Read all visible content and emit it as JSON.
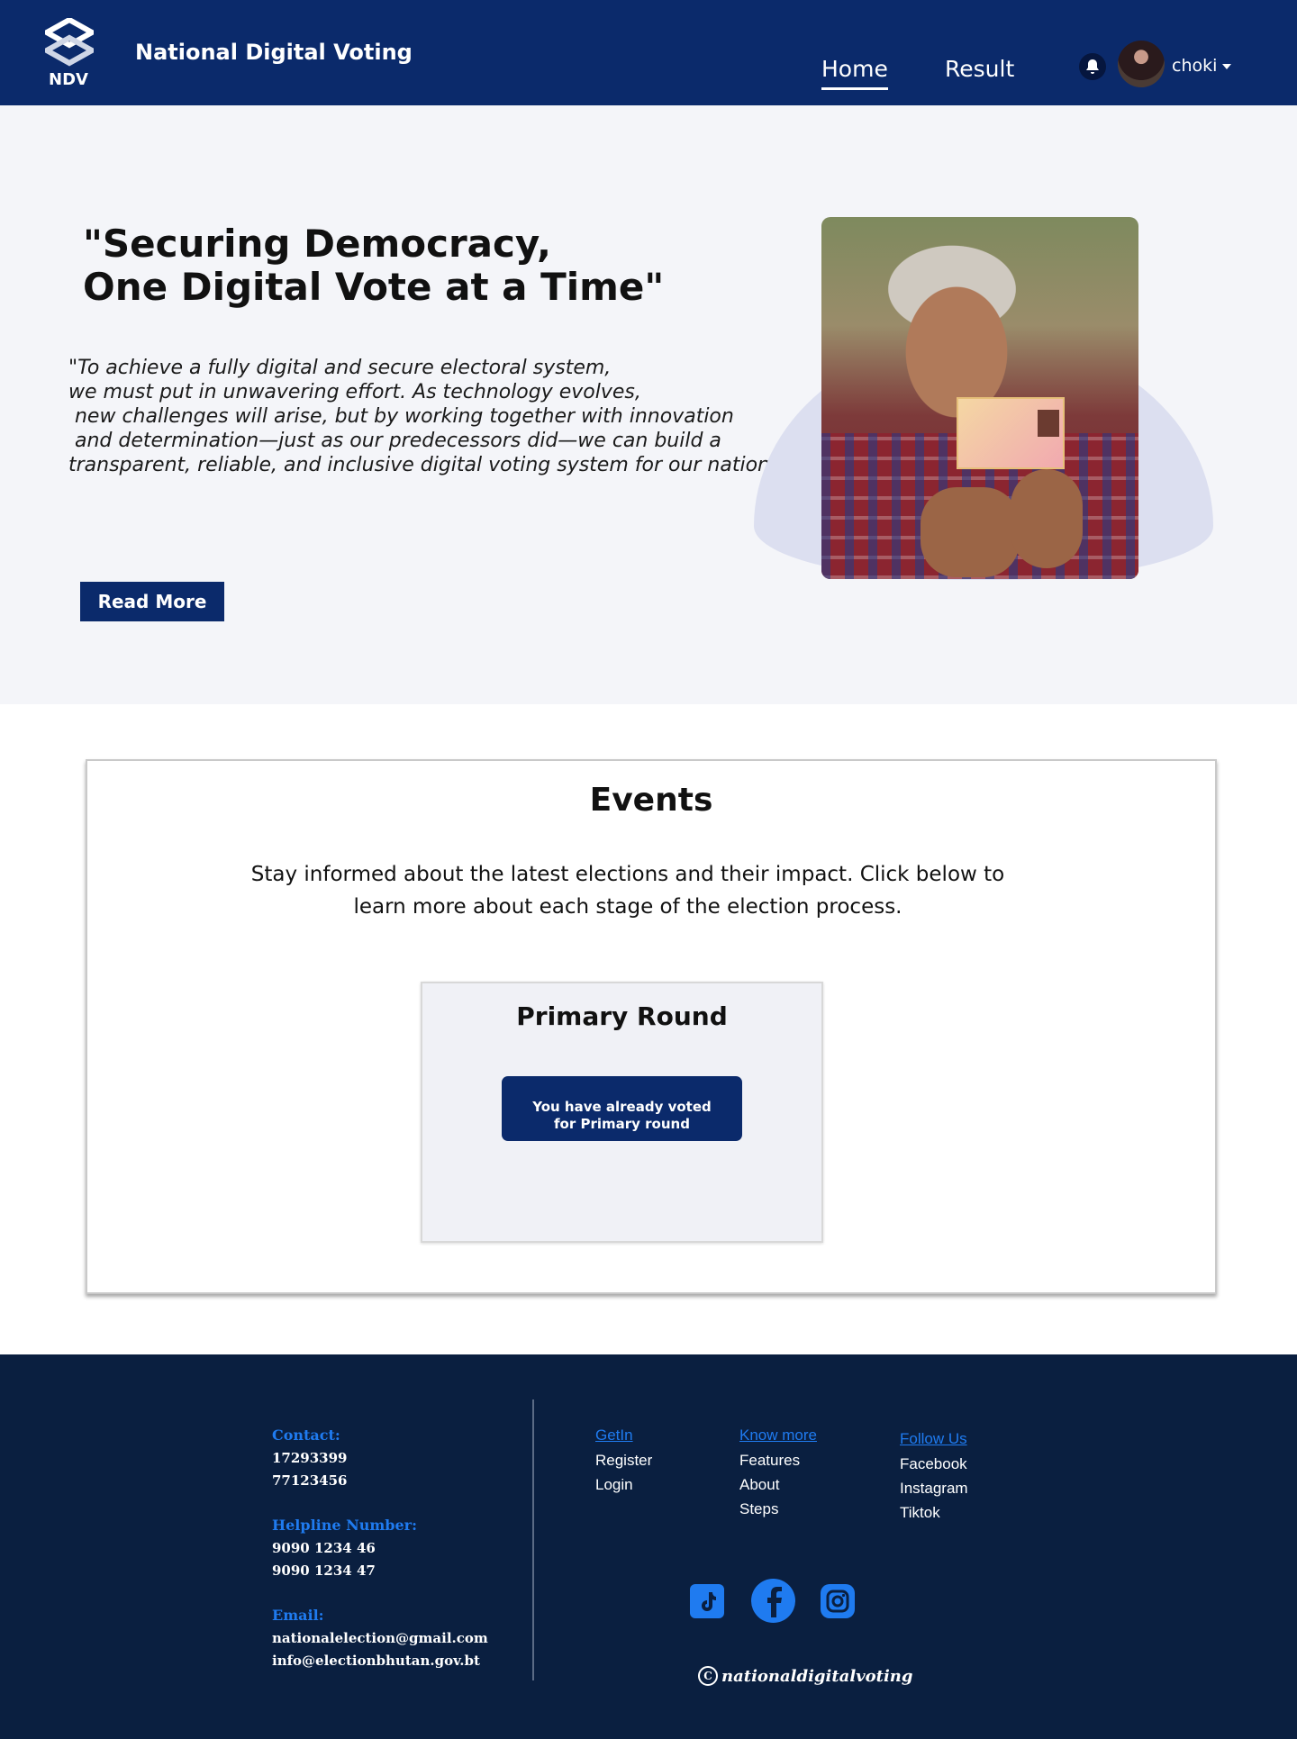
{
  "header": {
    "logo_text": "NDV",
    "brand": "National Digital Voting",
    "nav": {
      "home": "Home",
      "result": "Result"
    },
    "user": "choki"
  },
  "hero": {
    "title": "\"Securing Democracy,\nOne Digital Vote at a Time\"",
    "quote": "\"To achieve a fully digital and secure electoral system,\nwe must put in unwavering effort. As technology evolves,\n new challenges will arise, but by working together with innovation\n and determination—just as our predecessors did—we can build a\ntransparent, reliable, and inclusive digital voting system for our nation.\"",
    "read_more": "Read More"
  },
  "events": {
    "title": "Events",
    "description": "Stay informed about the latest elections and their impact. Click below to learn more about each stage of the election process.",
    "card": {
      "title": "Primary Round",
      "status_button": "You have already voted\nfor Primary round"
    }
  },
  "footer": {
    "contact_label": "Contact:",
    "contact_numbers": "17293399\n77123456",
    "helpline_label": "Helpline Number:",
    "helpline_numbers": "9090 1234 46\n9090 1234 47",
    "email_label": "Email:",
    "emails": "nationalelection@gmail.com\ninfo@electionbhutan.gov.bt",
    "getin": {
      "heading": "GetIn",
      "links": [
        "Register",
        "Login"
      ]
    },
    "knowmore": {
      "heading": "Know more",
      "links": [
        "Features",
        "About",
        "Steps"
      ]
    },
    "follow": {
      "heading": "Follow Us",
      "links": [
        "Facebook",
        "Instagram",
        "Tiktok"
      ]
    },
    "social_icons": [
      "tiktok-icon",
      "facebook-icon",
      "instagram-icon"
    ],
    "copyright": "nationaldigitalvoting"
  },
  "colors": {
    "primary_navy": "#0b2a6b",
    "footer_bg": "#0a1f40",
    "accent_blue": "#1f7bf0",
    "hero_bg": "#f4f5f9"
  }
}
